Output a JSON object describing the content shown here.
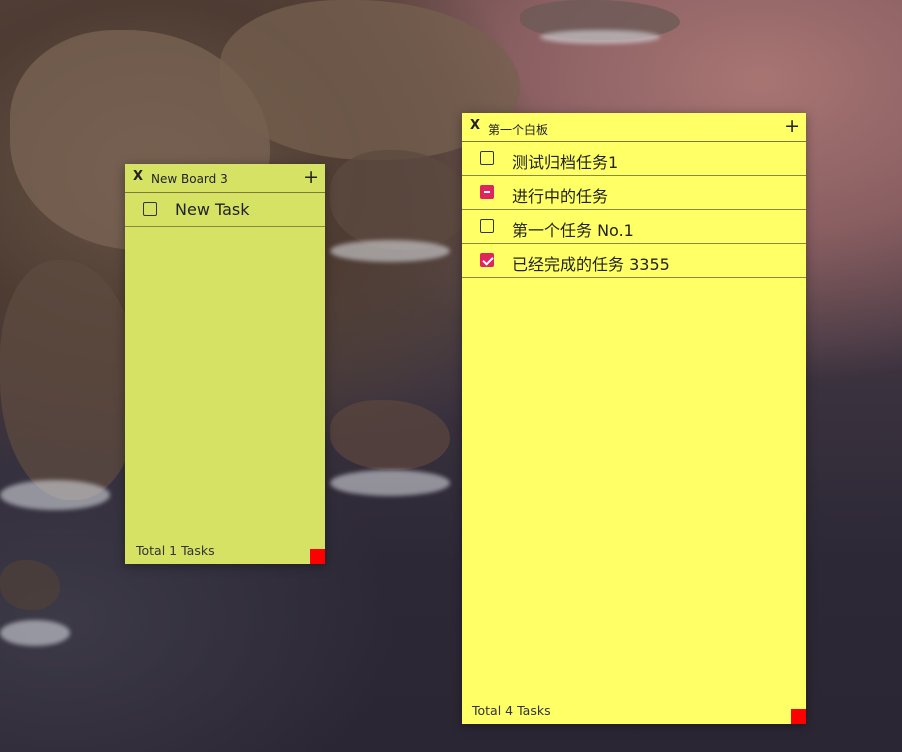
{
  "boards": [
    {
      "close_label": "X",
      "title": "New Board 3",
      "add_label": "+",
      "background": "#d6e263",
      "tasks": [
        {
          "label": "New Task",
          "state": "todo"
        }
      ],
      "total_text": "Total 1 Tasks"
    },
    {
      "close_label": "X",
      "title": "第一个白板",
      "add_label": "+",
      "background": "#ffff66",
      "tasks": [
        {
          "label": "测试归档任务1",
          "state": "todo"
        },
        {
          "label": "进行中的任务",
          "state": "in-progress"
        },
        {
          "label": "第一个任务 No.1",
          "state": "todo"
        },
        {
          "label": "已经完成的任务  3355",
          "state": "done"
        }
      ],
      "total_text": "Total 4 Tasks"
    }
  ],
  "colors": {
    "checkbox_accent": "#e0245e",
    "resize_handle": "#ff0000"
  }
}
